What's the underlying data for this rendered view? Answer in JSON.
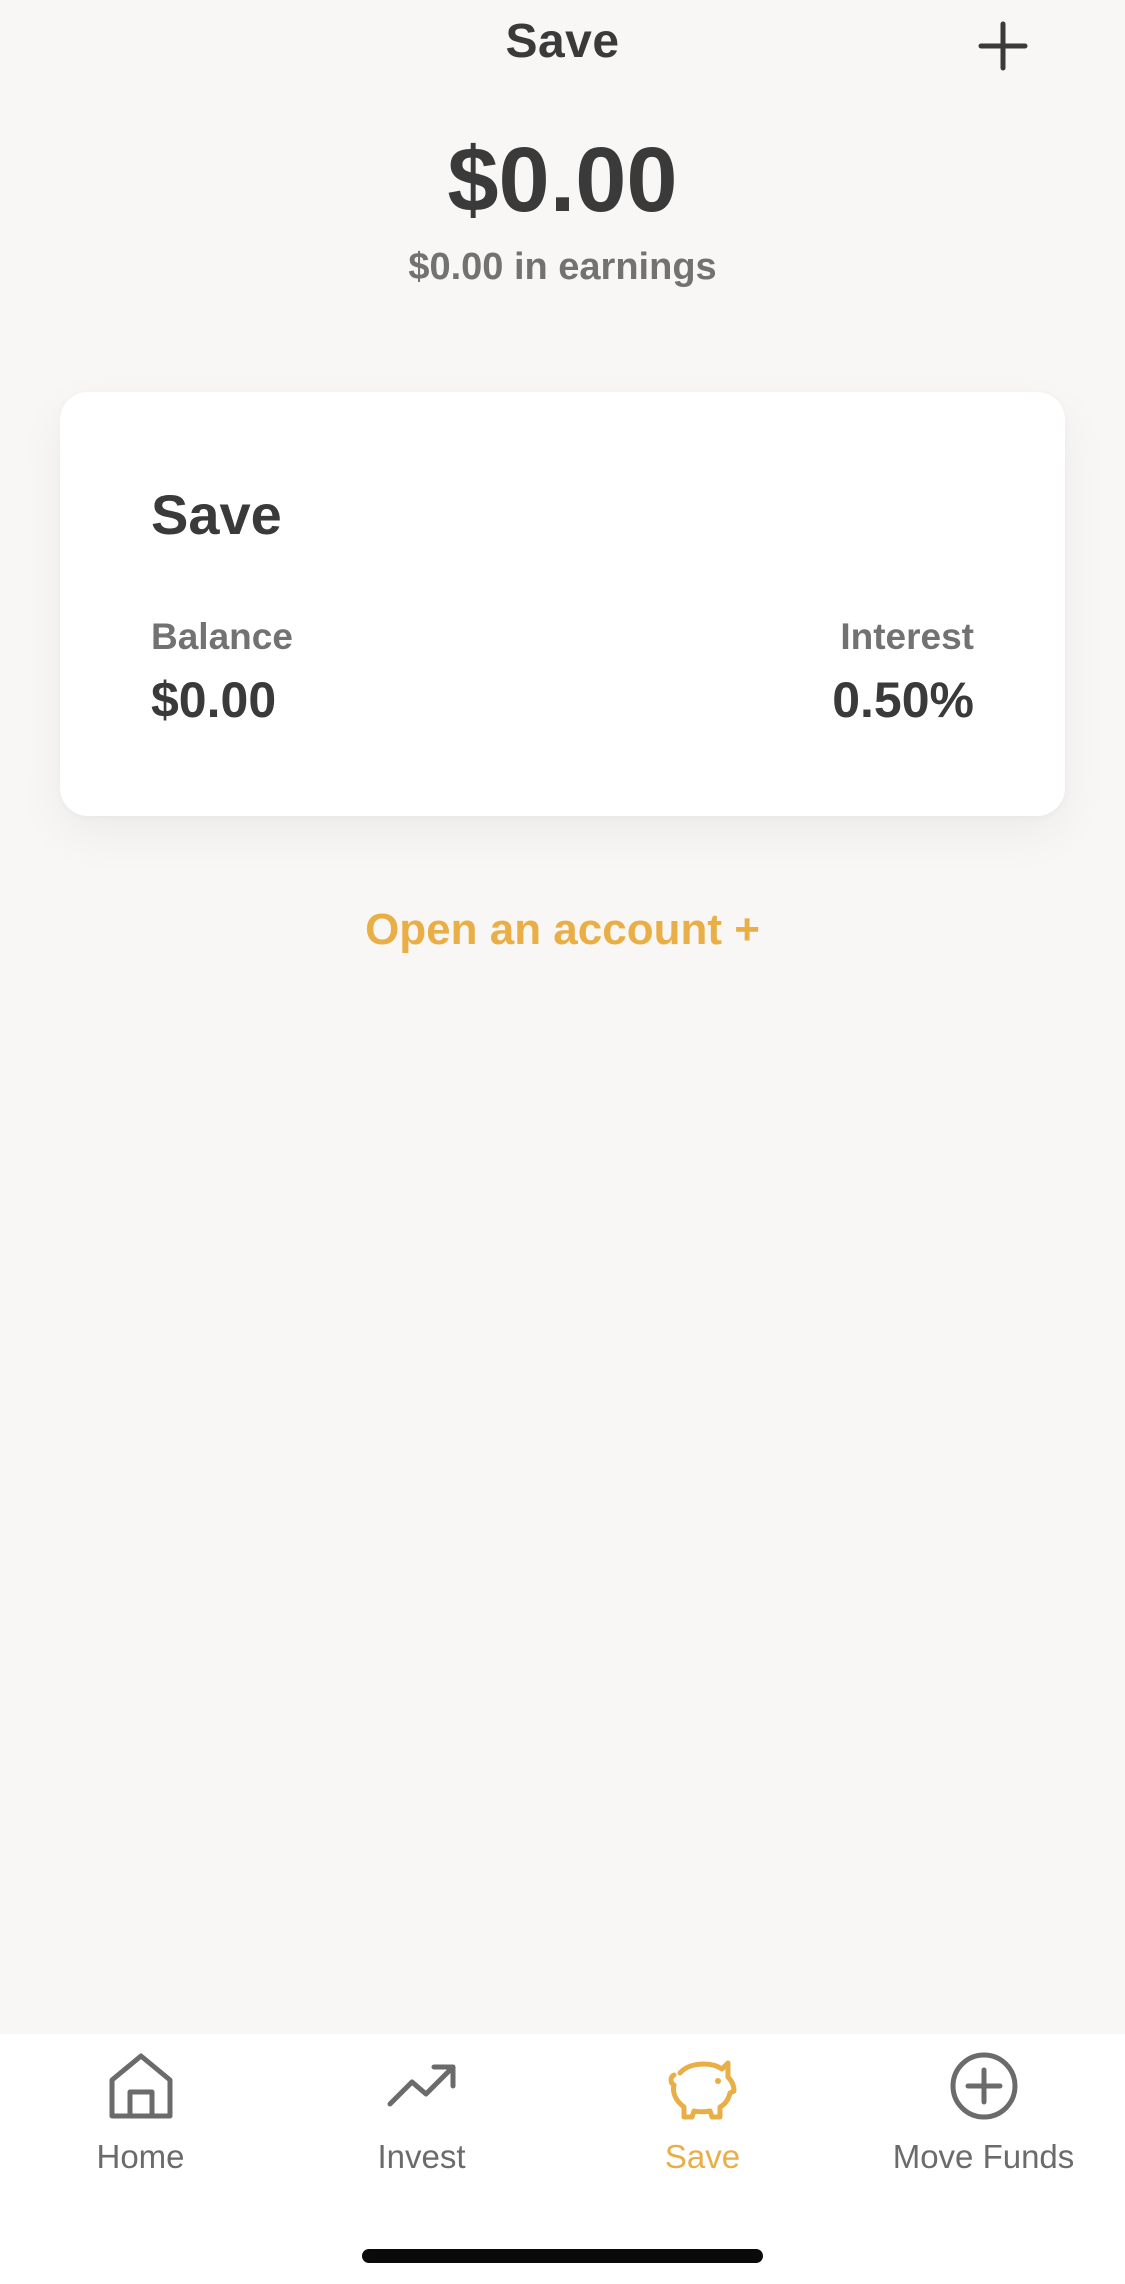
{
  "header": {
    "title": "Save",
    "add_icon": "plus-icon"
  },
  "summary": {
    "total_balance": "$0.00",
    "earnings": "$0.00 in earnings"
  },
  "account_card": {
    "title": "Save",
    "balance_label": "Balance",
    "balance_value": "$0.00",
    "interest_label": "Interest",
    "interest_value": "0.50%"
  },
  "open_account_link": "Open an account +",
  "tabs": [
    {
      "label": "Home",
      "icon": "home-icon",
      "active": false
    },
    {
      "label": "Invest",
      "icon": "trending-up-icon",
      "active": false
    },
    {
      "label": "Save",
      "icon": "piggy-bank-icon",
      "active": true
    },
    {
      "label": "Move Funds",
      "icon": "plus-circle-icon",
      "active": false
    }
  ],
  "colors": {
    "accent": "#e9ae45",
    "text_primary": "#3a3a3a",
    "text_secondary": "#727272",
    "background": "#f8f7f6",
    "card": "#ffffff"
  }
}
